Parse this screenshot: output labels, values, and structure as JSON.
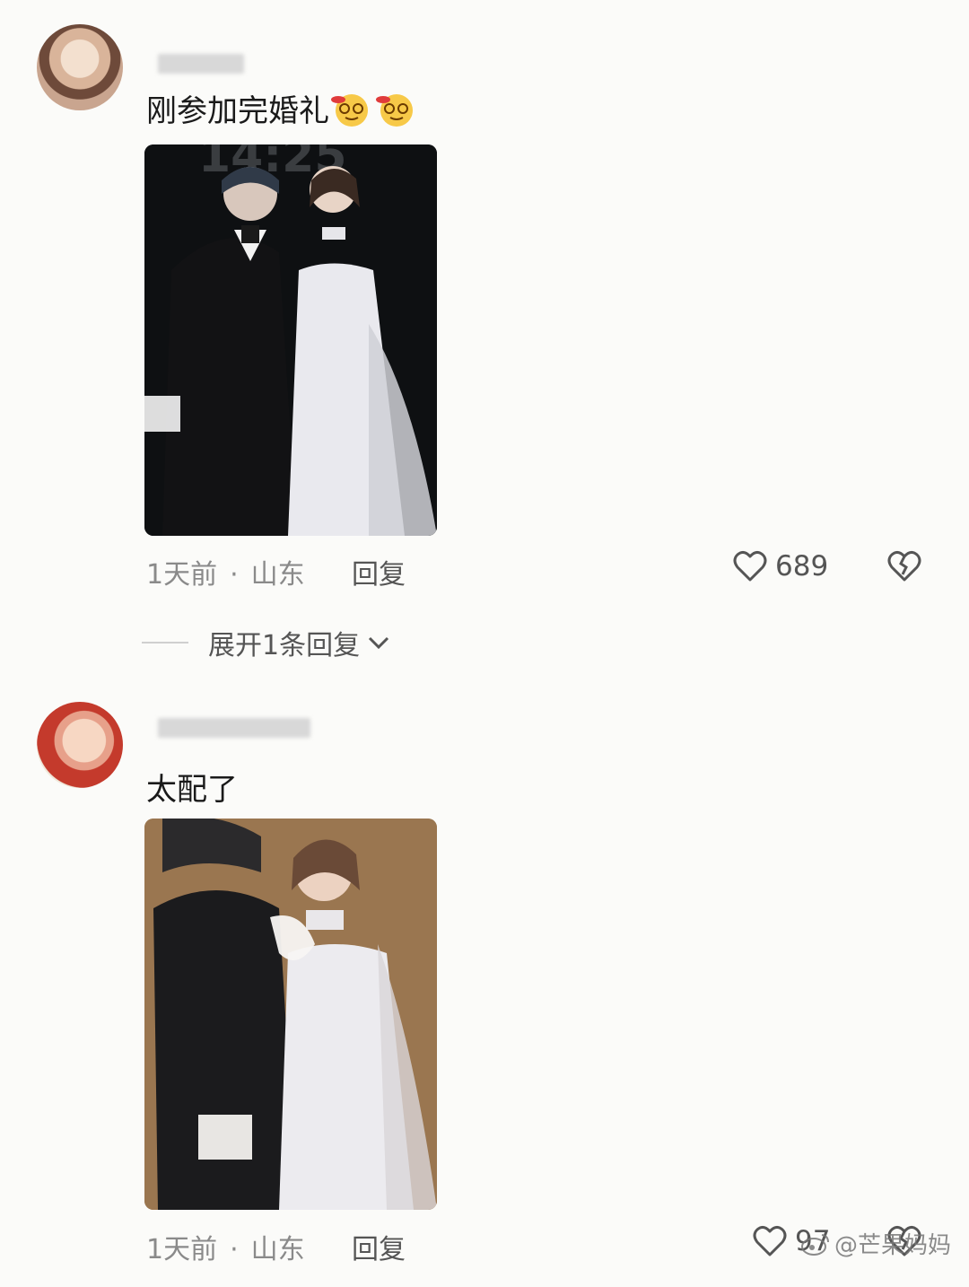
{
  "comments": [
    {
      "text": "刚参加完婚礼",
      "emoji": [
        "dizzy-drunk-emoji",
        "dizzy-drunk-emoji"
      ],
      "time": "1天前",
      "location": "山东",
      "reply_label": "回复",
      "likes": "689"
    },
    {
      "text": "太配了",
      "time": "1天前",
      "location": "山东",
      "reply_label": "回复",
      "likes": "97"
    }
  ],
  "expand_replies": "展开1条回复",
  "separator": "·",
  "watermark": "@芒果妈妈",
  "photo1_overlay_text": "14:25"
}
